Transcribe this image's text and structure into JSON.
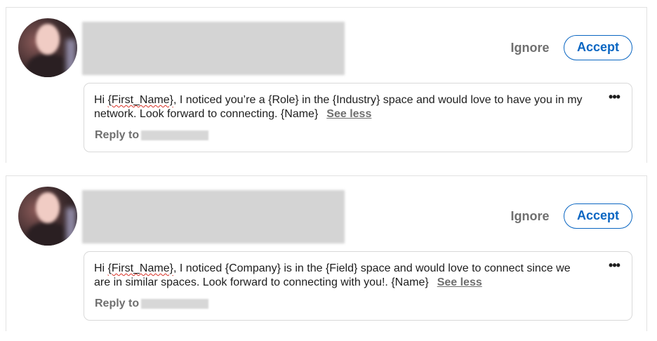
{
  "invitations": [
    {
      "actions": {
        "ignore_label": "Ignore",
        "accept_label": "Accept"
      },
      "message": {
        "greeting": "Hi ",
        "placeholder": "{First_Name}",
        "body": ", I noticed you’re a {Role} in the {Industry} space and would love to have you in my network. Look forward to connecting. {Name}",
        "toggle_label": "See less"
      },
      "more_icon": "more-horizontal-icon",
      "reply_label": "Reply to"
    },
    {
      "actions": {
        "ignore_label": "Ignore",
        "accept_label": "Accept"
      },
      "message": {
        "greeting": "Hi ",
        "placeholder": "{First_Name}",
        "body": ", I noticed {Company} is in the {Field} space and would love to connect since we are in similar spaces. Look forward to connecting with you!. {Name}",
        "toggle_label": "See less"
      },
      "more_icon": "more-horizontal-icon",
      "reply_label": "Reply to"
    }
  ],
  "colors": {
    "accent": "#0a66c2",
    "muted_text": "#6f6f6f",
    "body_text": "#1d1d1d",
    "card_border": "#d9d9d9",
    "spellcheck": "#d93025"
  }
}
